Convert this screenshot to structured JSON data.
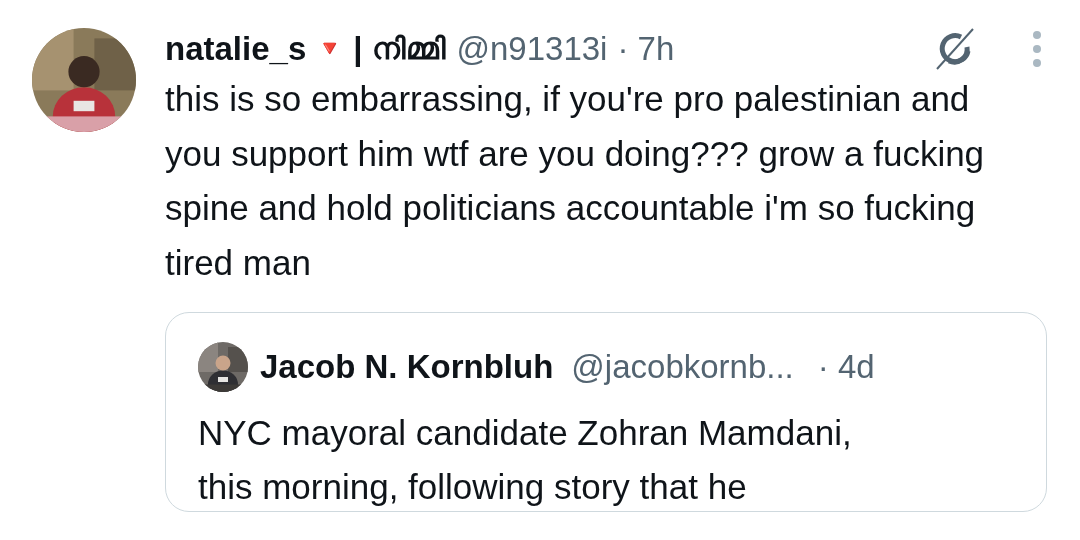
{
  "tweet": {
    "author": {
      "display_name": "natalie_s",
      "flag": "🔻",
      "separator": "|",
      "alt_name": "നിമ്മി",
      "handle": "@n91313i",
      "time": "· 7h"
    },
    "text": "this is so embarrassing, if you're pro palestinian and you support him wtf are you doing??? grow a fucking spine and hold politicians accountable i'm so fucking tired man",
    "quoted": {
      "author": {
        "display_name": "Jacob N. Kornbluh",
        "handle": "@jacobkornb...",
        "time": "· 4d"
      },
      "text": "NYC mayoral candidate Zohran Mamdani,",
      "text_cut": "this morning, following story that he"
    }
  }
}
